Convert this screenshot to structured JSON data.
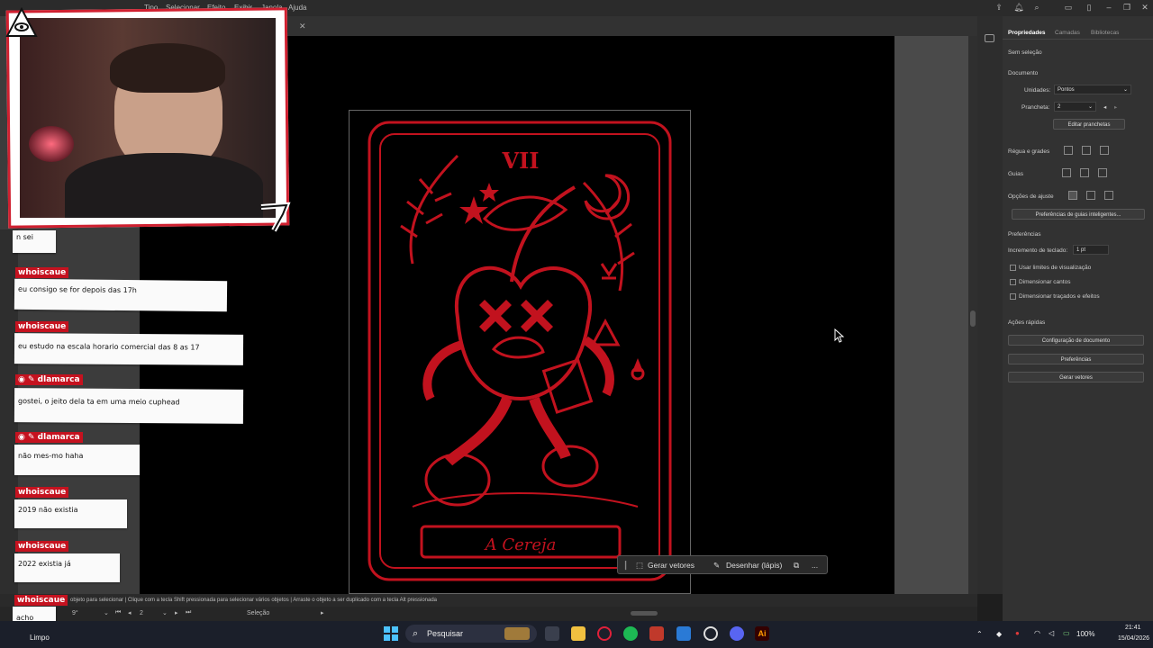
{
  "menubar": {
    "items": [
      "Tipo",
      "Selecionar",
      "Efeito",
      "Exibir",
      "Janela",
      "Ajuda"
    ]
  },
  "properties_panel": {
    "tabs": [
      "Propriedades",
      "Camadas",
      "Bibliotecas"
    ],
    "selection_state": "Sem seleção",
    "document_header": "Documento",
    "units_label": "Unidades:",
    "units_value": "Pontos",
    "artboard_label": "Prancheta:",
    "artboard_value": "2",
    "edit_artboards_button": "Editar pranchetas",
    "rulers_grids_label": "Régua e grades",
    "guides_label": "Guias",
    "snap_options_label": "Opções de ajuste",
    "smart_guides_button": "Preferências de guias inteligentes...",
    "preferences_header": "Preferências",
    "keyboard_increment_label": "Incremento de teclado:",
    "keyboard_increment_value": "1 pt",
    "checkboxes": [
      "Usar limites de visualização",
      "Dimensionar cantos",
      "Dimensionar traçados e efeitos"
    ],
    "quick_actions_header": "Ações rápidas",
    "quick_actions": [
      "Configuração de documento",
      "Preferências",
      "Gerar vetores"
    ]
  },
  "artwork": {
    "numeral": "VII",
    "title": "A Cereja",
    "colors": {
      "stroke": "#c2121e",
      "background": "#000000"
    }
  },
  "floating_toolbar": {
    "generate_vectors": "Gerar vetores",
    "draw_pencil": "Desenhar (lápis)",
    "more_label": "..."
  },
  "statusbar": {
    "text": "objeto para selecionar  |  Clique com a tecla Shift pressionada para selecionar vários objetos  |  Arraste o objeto a ser duplicado com a tecla Alt pressionada",
    "zoom": "9°",
    "artboard_nav": "2",
    "tool_status": "Seleção"
  },
  "chat": [
    {
      "user": "",
      "text": "n sei",
      "badges": ""
    },
    {
      "user": "whoiscaue",
      "text": "eu consigo se for depois das 17h",
      "badges": ""
    },
    {
      "user": "whoiscaue",
      "text": "eu estudo na escala horario comercial das 8 as 17",
      "badges": ""
    },
    {
      "user": "dlamarca",
      "text": "gostei, o jeito dela ta em uma meio cuphead",
      "badges": "◉ ✎"
    },
    {
      "user": "dlamarca",
      "text": "não mes-mo haha",
      "badges": "◉ ✎"
    },
    {
      "user": "whoiscaue",
      "text": "2019 não existia",
      "badges": ""
    },
    {
      "user": "whoiscaue",
      "text": "2022 existia já",
      "badges": ""
    },
    {
      "user": "whoiscaue",
      "text": "acho",
      "badges": ""
    }
  ],
  "weather": {
    "label": "Limpo"
  },
  "taskbar": {
    "search_placeholder": "Pesquisar",
    "battery": "100%",
    "time": "21:41",
    "date": "15/04/2026",
    "illustrator_label": "Ai"
  }
}
